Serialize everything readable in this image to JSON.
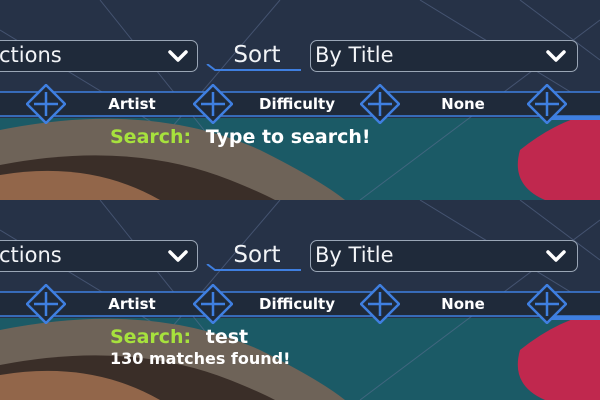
{
  "top_panel": {
    "left_dropdown_value": "ctions",
    "sort_label": "Sort",
    "sort_value": "By Title",
    "filters": [
      "Artist",
      "Difficulty",
      "None"
    ],
    "search_label": "Search:",
    "search_text": "Type to search!"
  },
  "bottom_panel": {
    "left_dropdown_value": "ctions",
    "sort_label": "Sort",
    "sort_value": "By Title",
    "filters": [
      "Artist",
      "Difficulty",
      "None"
    ],
    "search_label": "Search:",
    "search_text": "test",
    "matches_text": "130 matches found!"
  },
  "colors": {
    "search_label": "#a7e23d",
    "accent_blue": "#3f7fe0",
    "dropdown_bg": "#1f2a3a"
  },
  "icons": [
    "chevron-down-icon",
    "plus-icon"
  ]
}
